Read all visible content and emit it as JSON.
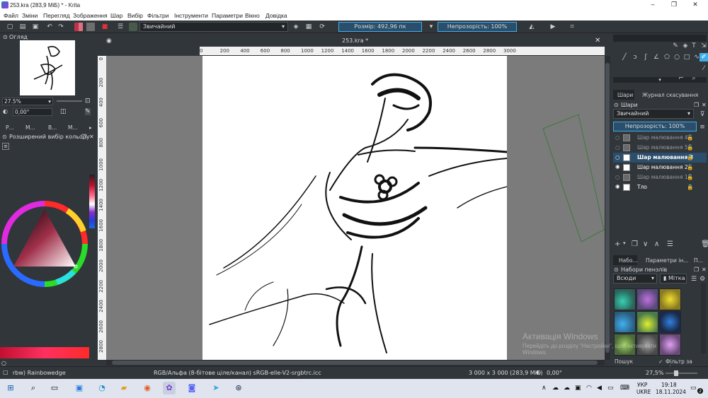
{
  "window": {
    "title": "253.kra (283,9 МіБ)  * - Krita",
    "minimize": "–",
    "maximize": "❐",
    "close": "✕"
  },
  "menu": [
    "Файл",
    "Зміни",
    "Перегляд",
    "Зображення",
    "Шар",
    "Вибір",
    "Фільтри",
    "Інструменти",
    "Параметри",
    "Вікно",
    "Довідка"
  ],
  "toolbar": {
    "blend_mode": "Звичайний",
    "size_label": "Розмір: 492,96 пк",
    "opacity_label": "Непрозорість: 100%"
  },
  "document": {
    "tab_title": "253.kra *",
    "close": "✕"
  },
  "ruler": {
    "h_ticks": [
      "0",
      "200",
      "400",
      "600",
      "800",
      "1000",
      "1200",
      "1400",
      "1600",
      "1800",
      "2000",
      "2200",
      "2400",
      "2600",
      "2800",
      "3000"
    ],
    "v_ticks": [
      "0",
      "200",
      "400",
      "600",
      "800",
      "1000",
      "1200",
      "1400",
      "1600",
      "1800",
      "2000",
      "2200",
      "2400",
      "2600",
      "2800"
    ]
  },
  "overview": {
    "title": "Огляд",
    "zoom": "27.5%",
    "rotation": "0,00°"
  },
  "left_tabs": [
    "Р...",
    "М...",
    "В...",
    "М..."
  ],
  "color_selector": {
    "title": "Розширений вибір кольору"
  },
  "right_panel": {
    "tabs": [
      "Шари",
      "Журнал скасування"
    ],
    "layers_title": "Шари",
    "blend_mode": "Звичайний",
    "opacity": "Непрозорість:  100%",
    "layers": [
      {
        "name": "Шар малювання 4",
        "active": false,
        "visible": false
      },
      {
        "name": "Шар малювання 5",
        "active": false,
        "visible": false
      },
      {
        "name": "Шар малювання 3",
        "active": true,
        "visible": false
      },
      {
        "name": "Шар малювання 2",
        "active": false,
        "visible": true
      },
      {
        "name": "Шар малювання 1",
        "active": false,
        "visible": false
      },
      {
        "name": "Тло",
        "active": false,
        "visible": true
      }
    ],
    "bottom_tabs": [
      "Набо...",
      "Параметри ін...",
      "П..."
    ],
    "brush_title": "Набори пензлів",
    "brush_filter": "Всюди",
    "brush_tag": "Мітка",
    "search_label": "Пошук",
    "filter_by_tag": "Фільтр за міткою"
  },
  "status": {
    "brush": "rbw) Rainbowedge",
    "color_model": "RGB/Альфа (8-бітове ціле/канал)  sRGB-elle-V2-srgbtrc.icc",
    "dimensions": "3 000 x 3 000 (283,9 МіБ)",
    "rotation": "0,00°",
    "zoom": "27,5%"
  },
  "watermark": {
    "line1": "Активація Windows",
    "line2": "Перейдіть до розділу \"Настройки\", щоб активувати",
    "line3": "Windows."
  },
  "taskbar": {
    "lang1": "УКР",
    "lang2": "UKRE",
    "time": "19:18",
    "date": "18.11.2024",
    "notify": "2"
  },
  "colors": {
    "accent": "#3daee9",
    "panel": "#31363b",
    "canvas_bg": "#7b7b7b"
  }
}
